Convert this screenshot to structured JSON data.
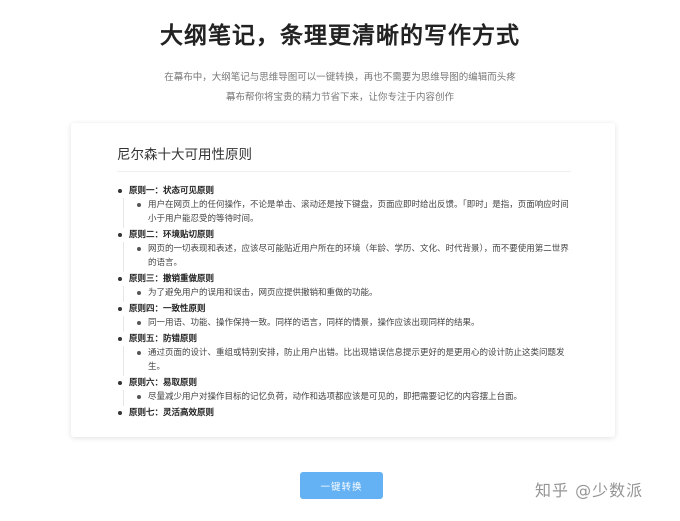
{
  "hero": {
    "title": "大纲笔记，条理更清晰的写作方式",
    "subtitle_line1": "在幕布中，大纲笔记与思维导图可以一键转换，再也不需要为思维导图的编辑而头疼",
    "subtitle_line2": "幕布帮你将宝贵的精力节省下来，让你专注于内容创作"
  },
  "card": {
    "title": "尼尔森十大可用性原则",
    "items": [
      {
        "head": "原则一：状态可见原则",
        "body": "用户在网页上的任何操作，不论是单击、滚动还是按下键盘，页面应即时给出反馈。「即时」是指，页面响应时间小于用户能忍受的等待时间。"
      },
      {
        "head": "原则二：环境贴切原则",
        "body": "网页的一切表现和表述，应该尽可能贴近用户所在的环境（年龄、学历、文化、时代背景），而不要使用第二世界的语言。"
      },
      {
        "head": "原则三：撤销重做原则",
        "body": "为了避免用户的误用和误击，网页应提供撤销和重做的功能。"
      },
      {
        "head": "原则四：一致性原则",
        "body": "同一用语、功能、操作保持一致。同样的语言，同样的情景，操作应该出现同样的结果。"
      },
      {
        "head": "原则五：防错原则",
        "body": "通过页面的设计、重组或特别安排，防止用户出错。比出现错误信息提示更好的是更用心的设计防止这类问题发生。"
      },
      {
        "head": "原则六：易取原则",
        "body": "尽量减少用户对操作目标的记忆负荷，动作和选项都应该是可见的，即把需要记忆的内容摆上台面。"
      },
      {
        "head": "原则七：灵活高效原则",
        "body": ""
      }
    ]
  },
  "actions": {
    "convert_label": "一键转换"
  },
  "watermark": "知乎 @少数派",
  "colors": {
    "accent": "#64b1f4"
  }
}
